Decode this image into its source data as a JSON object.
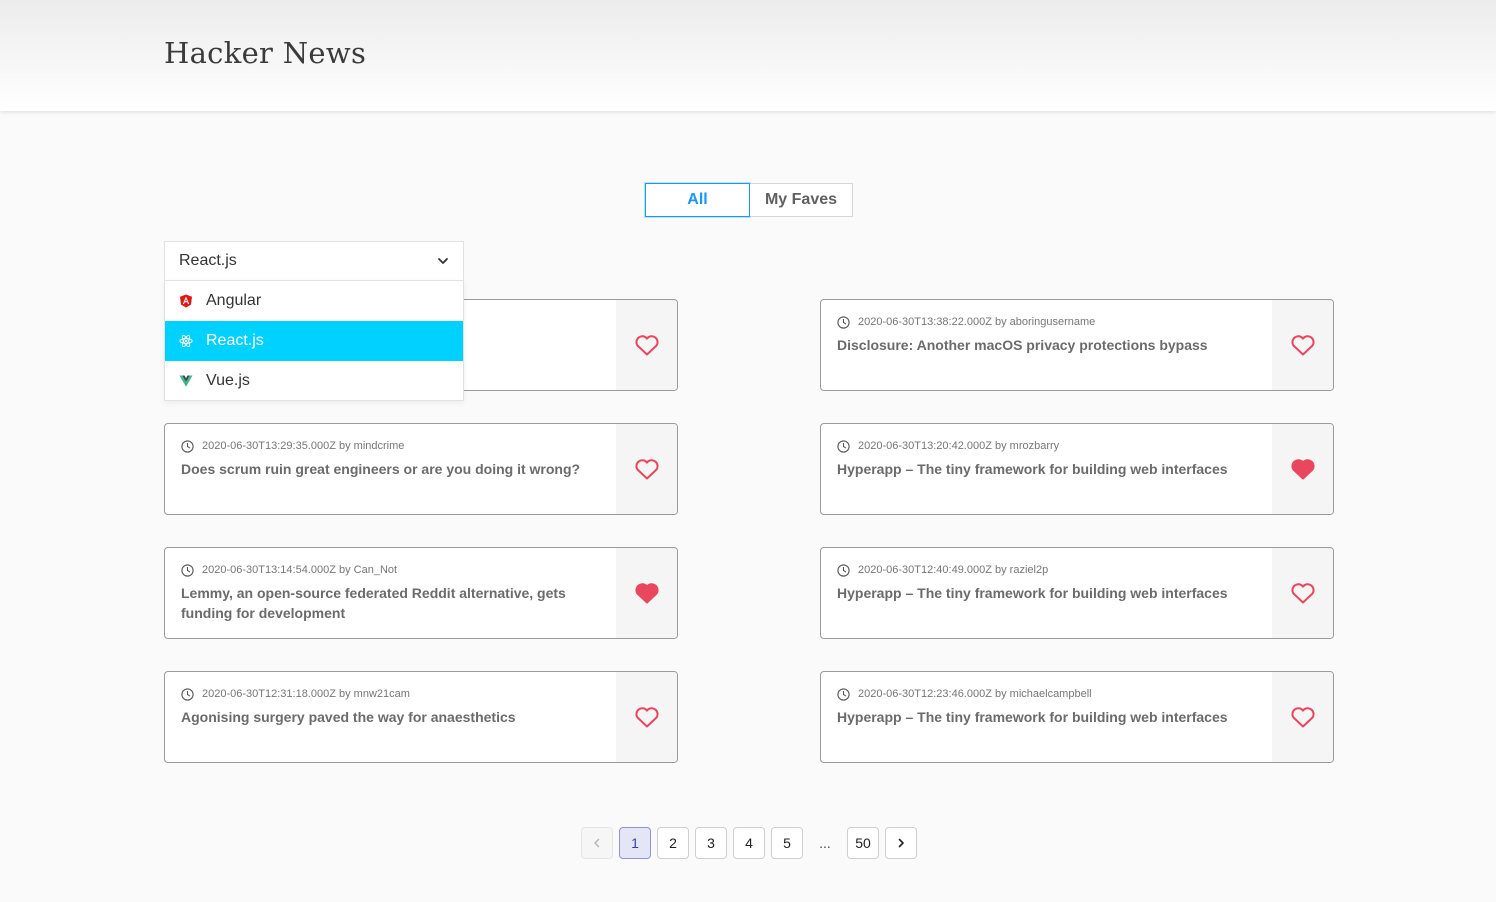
{
  "header": {
    "title": "Hacker News"
  },
  "tabs": {
    "all_label": "All",
    "faves_label": "My Faves"
  },
  "filter": {
    "selected": "React.js",
    "options": [
      {
        "label": "Angular",
        "icon": "angular-icon"
      },
      {
        "label": "React.js",
        "icon": "react-icon",
        "highlighted": true
      },
      {
        "label": "Vue.js",
        "icon": "vue-icon"
      }
    ]
  },
  "posts": [
    {
      "meta": "",
      "title": "",
      "favorited": false
    },
    {
      "meta": "2020-06-30T13:38:22.000Z by aboringusername",
      "title": "Disclosure: Another macOS privacy protections bypass",
      "favorited": false
    },
    {
      "meta": "2020-06-30T13:29:35.000Z by mindcrime",
      "title": "Does scrum ruin great engineers or are you doing it wrong?",
      "favorited": false
    },
    {
      "meta": "2020-06-30T13:20:42.000Z by mrozbarry",
      "title": "Hyperapp – The tiny framework for building web interfaces",
      "favorited": true
    },
    {
      "meta": "2020-06-30T13:14:54.000Z by Can_Not",
      "title": "Lemmy, an open-source federated Reddit alternative, gets funding for development",
      "favorited": true
    },
    {
      "meta": "2020-06-30T12:40:49.000Z by raziel2p",
      "title": "Hyperapp – The tiny framework for building web interfaces",
      "favorited": false
    },
    {
      "meta": "2020-06-30T12:31:18.000Z by mnw21cam",
      "title": "Agonising surgery paved the way for anaesthetics",
      "favorited": false
    },
    {
      "meta": "2020-06-30T12:23:46.000Z by michaelcampbell",
      "title": "Hyperapp – The tiny framework for building web interfaces",
      "favorited": false
    }
  ],
  "pagination": {
    "pages": [
      "1",
      "2",
      "3",
      "4",
      "5"
    ],
    "ellipsis": "...",
    "last": "50",
    "current": "1"
  },
  "colors": {
    "accent": "#1797ff",
    "highlight": "#00d1ff",
    "heart": "#e8475d"
  }
}
